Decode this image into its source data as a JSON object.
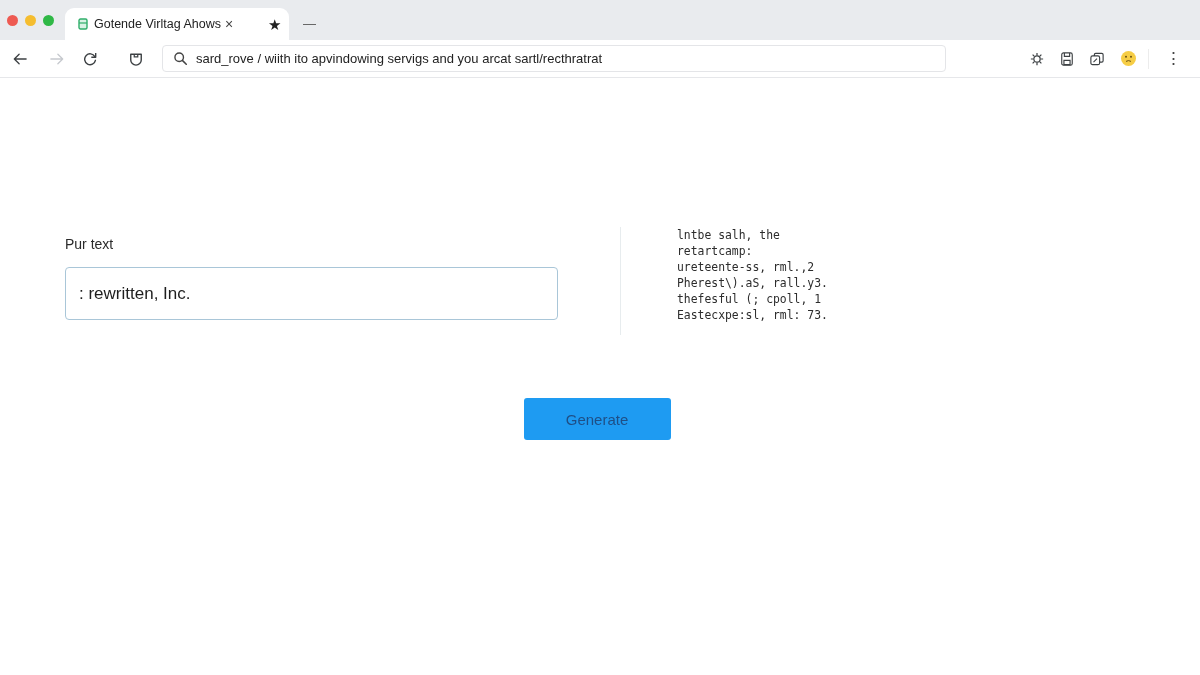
{
  "window_controls": [
    {
      "color": "#ee5a52"
    },
    {
      "color": "#f5bd2f"
    },
    {
      "color": "#2fb846"
    }
  ],
  "tabs": [
    {
      "title": "Gotende Virltag Ahows",
      "close": "×",
      "selected": true
    }
  ],
  "tab_strip": {
    "star": "★",
    "new_tab": "—"
  },
  "nav_buttons": [
    {
      "kind": "back",
      "disabled": false
    },
    {
      "kind": "forward",
      "disabled": true
    },
    {
      "kind": "reload",
      "disabled": false
    },
    {
      "kind": "shield",
      "disabled": false
    }
  ],
  "address_bar": {
    "value": "sard_rove / wiith ito apvindowing servigs and you arcat sartl/recthratrat"
  },
  "toolbar_icons": [
    {
      "kind": "gear"
    },
    {
      "kind": "floppy"
    },
    {
      "kind": "copy"
    },
    {
      "kind": "emoji"
    }
  ],
  "menu": "⋮",
  "form": {
    "label": "Pur text",
    "value": ": rewritten, Inc.",
    "button": "Generate"
  },
  "output": {
    "lines": [
      "lntbe salh, the",
      "retartcamp:",
      "ureteente-ss, rml.,2",
      "Pherest\\).aS, rall.y3.",
      "thefesful (; cpoll, 1",
      "Eastecxpe:sl, rml: 73."
    ]
  }
}
